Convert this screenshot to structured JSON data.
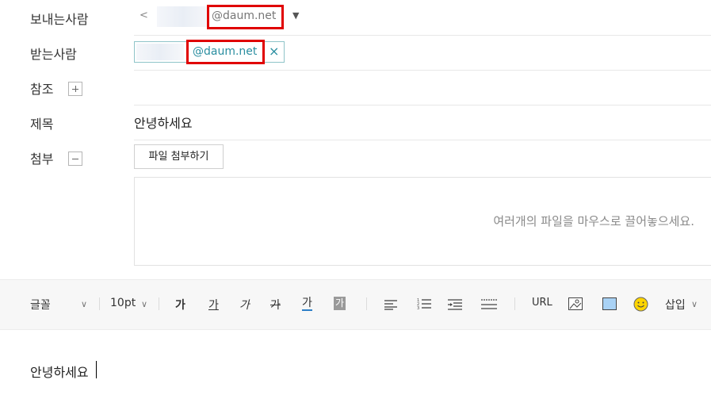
{
  "fields": {
    "sender": {
      "label": "보내는사람",
      "prefix": "<",
      "domain": "@daum.net"
    },
    "recipient": {
      "label": "받는사람",
      "domain": "@daum.net",
      "remove_glyph": "×"
    },
    "cc": {
      "label": "참조"
    },
    "subject": {
      "label": "제목",
      "value": "안녕하세요"
    },
    "attach": {
      "label": "첨부",
      "button": "파일 첨부하기",
      "drop_hint": "여러개의 파일을 마우스로 끌어놓으세요."
    }
  },
  "toolbar": {
    "font": "글꼴",
    "size": "10pt",
    "bold": "가",
    "underline": "가",
    "italic": "가",
    "strike": "가",
    "font_color": "가",
    "bg_color": "가",
    "url": "URL",
    "insert": "삽입"
  },
  "body": {
    "text": "안녕하세요"
  },
  "colors": {
    "highlight_box": "#e00000",
    "tag_text": "#2a8ea0",
    "tag_border": "#8fc4c9"
  }
}
